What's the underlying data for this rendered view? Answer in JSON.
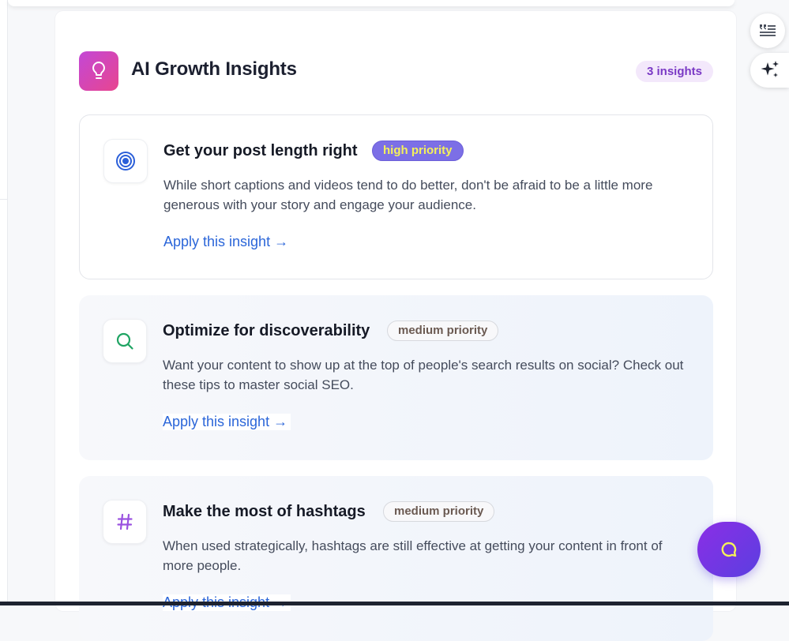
{
  "header": {
    "title": "AI Growth Insights",
    "count_badge": "3 insights",
    "icon": "lightbulb-icon"
  },
  "insights": [
    {
      "icon": "target-icon",
      "title": "Get your post length right",
      "priority": "high priority",
      "description": "While short captions and videos tend to do better, don't be afraid to be a little more generous with your story and engage your audience.",
      "action": "Apply this insight →"
    },
    {
      "icon": "search-icon",
      "title": "Optimize for discoverability",
      "priority": "medium priority",
      "description": "Want your content to show up at the top of people's search results on social? Check out these tips to master social SEO.",
      "action": "Apply this insight →"
    },
    {
      "icon": "hashtag-icon",
      "title": "Make the most of hashtags",
      "priority": "medium priority",
      "description": "When used strategically, hashtags are still effective at getting your content in front of more people.",
      "action": "Apply this insight →"
    }
  ],
  "side_buttons": [
    "quote-list-icon",
    "sparkles-icon"
  ],
  "chat_button": "chat-icon",
  "colors": {
    "accent_purple": "#7a39c5",
    "link_blue": "#2b66d9",
    "high_priority_bg": "#7c6fe6",
    "high_priority_text": "#f4f15a"
  }
}
